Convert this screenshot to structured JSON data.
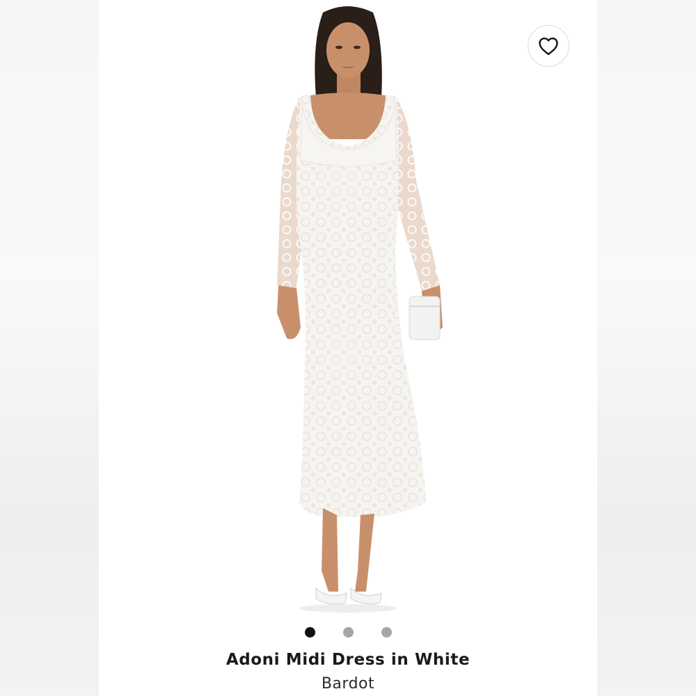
{
  "product": {
    "title": "Adoni Midi Dress in White",
    "brand": "Bardot",
    "image_alt": "Model wearing white lace long-sleeve midi dress"
  },
  "favorite": {
    "icon": "heart-icon",
    "active": false
  },
  "carousel": {
    "total_slides": 3,
    "active_index": 0
  },
  "colors": {
    "dot_active": "#111111",
    "dot_inactive": "#a6a6a6",
    "dress": "#f5f3ef",
    "skin": "#c8906a",
    "hair": "#2a1e19"
  }
}
